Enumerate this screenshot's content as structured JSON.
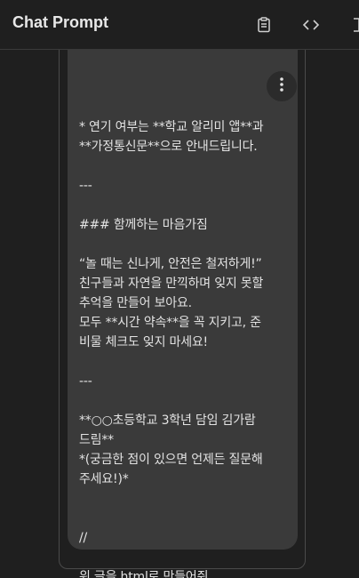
{
  "header": {
    "title": "Chat Prompt",
    "actions": [
      {
        "name": "clipboard-icon"
      },
      {
        "name": "code-icon"
      },
      {
        "name": "more-options-icon"
      }
    ]
  },
  "message": {
    "lines": [
      "* 연기 여부는 **학교 알리미 앱**과",
      "**가정통신문**으로 안내드립니다.",
      "",
      "---",
      "",
      "### 함께하는 마음가짐",
      "",
      "“놀 때는 신나게, 안전은 철저하게!”",
      "친구들과 자연을 만끽하며 잊지 못할",
      "추억을 만들어 보아요.",
      "모두 **시간 약속**을 꼭 지키고, 준",
      "비물 체크도 잊지 마세요!",
      "",
      "---",
      "",
      "**○○초등학교 3학년 담임 김가람",
      "드림**",
      "*(궁금한 점이 있으면 언제든 질문해",
      "주세요!)*",
      "",
      "",
      "//",
      "",
      "위 글을 html로 만들어줘"
    ]
  },
  "colors": {
    "background": "#1f1f1f",
    "bubble": "#3a3a3a",
    "text": "#e3e3e3"
  }
}
